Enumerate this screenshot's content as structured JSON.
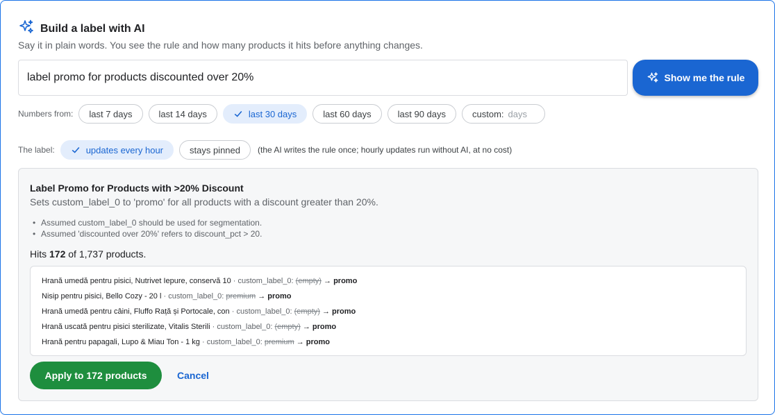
{
  "header": {
    "icon": "sparkle-icon",
    "title": "Build a label with AI",
    "subtitle": "Say it in plain words. You see the rule and how many products it hits before anything changes."
  },
  "prompt": {
    "value": "label promo for products discounted over 20%"
  },
  "show_rule_button": {
    "label": "Show me the rule",
    "icon": "sparkle-icon"
  },
  "numbers_from": {
    "label": "Numbers from:",
    "chips": [
      {
        "label": "last 7 days",
        "selected": false
      },
      {
        "label": "last 14 days",
        "selected": false
      },
      {
        "label": "last 30 days",
        "selected": true
      },
      {
        "label": "last 60 days",
        "selected": false
      },
      {
        "label": "last 90 days",
        "selected": false
      }
    ],
    "custom": {
      "label": "custom:",
      "placeholder": "days"
    }
  },
  "label_mode": {
    "label": "The label:",
    "chips": [
      {
        "label": "updates every hour",
        "selected": true
      },
      {
        "label": "stays pinned",
        "selected": false
      }
    ],
    "note": "(the AI writes the rule once; hourly updates run without AI, at no cost)"
  },
  "rule": {
    "title": "Label Promo for Products with >20% Discount",
    "description": "Sets custom_label_0 to 'promo' for all products with a discount greater than 20%.",
    "assumptions": [
      "Assumed custom_label_0 should be used for segmentation.",
      "Assumed 'discounted over 20%' refers to discount_pct > 20."
    ],
    "hits": {
      "prefix": "Hits",
      "count": "172",
      "suffix": "of 1,737 products."
    },
    "preview": [
      {
        "product": "Hrană umedă pentru pisici, Nutrivet Iepure, conservă 10",
        "field": "custom_label_0:",
        "old": "(empty)",
        "new": "promo"
      },
      {
        "product": "Nisip pentru pisici, Bello Cozy - 20 l",
        "field": "custom_label_0:",
        "old": "premium",
        "new": "promo"
      },
      {
        "product": "Hrană umedă pentru câini, Fluffo Rață și Portocale, con",
        "field": "custom_label_0:",
        "old": "(empty)",
        "new": "promo"
      },
      {
        "product": "Hrană uscată pentru pisici sterilizate, Vitalis Sterili",
        "field": "custom_label_0:",
        "old": "(empty)",
        "new": "promo"
      },
      {
        "product": "Hrană pentru papagali, Lupo & Miau Ton - 1 kg",
        "field": "custom_label_0:",
        "old": "premium",
        "new": "promo"
      }
    ]
  },
  "actions": {
    "apply_label": "Apply to 172 products",
    "cancel_label": "Cancel"
  },
  "colors": {
    "accent": "#1a66d2",
    "selected_chip_bg": "#e3edfc",
    "apply_green": "#1e8e3e",
    "card_border": "#1a73e8"
  }
}
